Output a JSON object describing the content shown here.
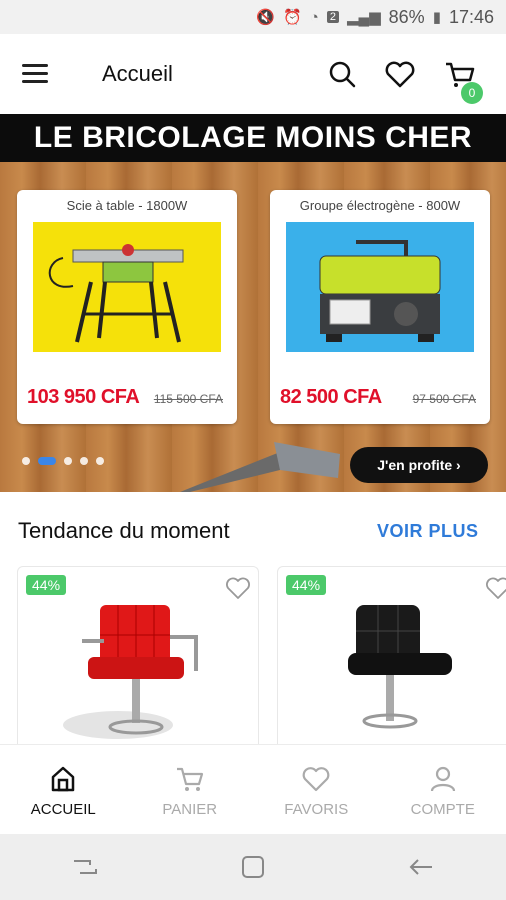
{
  "status_bar": {
    "battery": "86%",
    "time": "17:46",
    "sim_badge": "2"
  },
  "header": {
    "title": "Accueil",
    "cart_count": "0"
  },
  "banner": {
    "headline": "LE BRICOLAGE MOINS CHER",
    "cards": [
      {
        "title": "Scie à table - 1800W",
        "price": "103 950 CFA",
        "old_price": "115 500 CFA"
      },
      {
        "title": "Groupe électrogène - 800W",
        "price": "82 500 CFA",
        "old_price": "97 500 CFA"
      }
    ],
    "cta_label": "J'en profite ›",
    "active_slide": 2
  },
  "trending": {
    "title": "Tendance du moment",
    "see_more": "VOIR PLUS",
    "products": [
      {
        "discount": "44%"
      },
      {
        "discount": "44%"
      }
    ]
  },
  "bottom_nav": {
    "items": [
      {
        "label": "ACCUEIL",
        "icon": "home-icon",
        "active": true
      },
      {
        "label": "PANIER",
        "icon": "cart-icon",
        "active": false
      },
      {
        "label": "FAVORIS",
        "icon": "heart-icon",
        "active": false
      },
      {
        "label": "COMPTE",
        "icon": "user-icon",
        "active": false
      }
    ]
  },
  "colors": {
    "accent": "#2f7bd9",
    "badge": "#4cc96a",
    "price": "#e0102a"
  }
}
